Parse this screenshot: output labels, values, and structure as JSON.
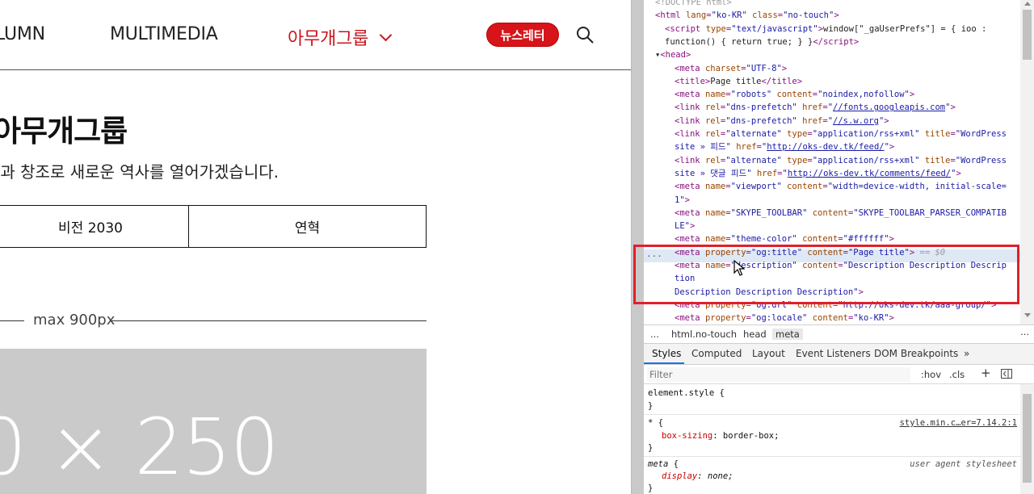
{
  "site": {
    "nav": {
      "column": "LUMN",
      "multimedia": "MULTIMEDIA",
      "group": "아무개그룹",
      "newsletter": "뉴스레터"
    },
    "title": "아무개그룹",
    "subtitle": "선과 창조로 새로운 역사를 열어가겠습니다.",
    "tabs": [
      "비전 2030",
      "연혁"
    ],
    "max_label": "max 900px",
    "placeholder_text": "0 × 250",
    "colors": {
      "accent": "#d7141a",
      "placeholder_bg": "#cacaca"
    }
  },
  "devtools": {
    "dom_lines": [
      {
        "indent": 0,
        "html": "&lt;!DOCTYPE html&gt;",
        "comment": true
      },
      {
        "indent": 0,
        "tag": "html",
        "attrs": [
          [
            "lang",
            "ko-KR"
          ],
          [
            "class",
            "no-touch"
          ]
        ]
      },
      {
        "indent": 1,
        "raw": "<span>&lt;script</span> <span class=\"attr\">type</span>=<span class=\"val\">\"text/javascript\"</span>&gt;<span class=\"txt\">window[\"_gaUserPrefs\"] = { ioo :</span>"
      },
      {
        "indent": 1,
        "raw": "<span class=\"txt\">function() { return true; } }</span>&lt;/script&gt;"
      },
      {
        "indent": 0,
        "raw": "<span class=\"txt\">▾</span>&lt;head&gt;"
      },
      {
        "indent": 2,
        "raw": "&lt;meta <span class=\"attr\">charset</span>=<span class=\"val\">\"UTF-8\"</span>&gt;"
      },
      {
        "indent": 2,
        "raw": "&lt;title&gt;<span class=\"txt\">Page title</span>&lt;/title&gt;"
      },
      {
        "indent": 2,
        "raw": "&lt;meta <span class=\"attr\">name</span>=<span class=\"val\">\"robots\"</span> <span class=\"attr\">content</span>=<span class=\"val\">\"noindex,nofollow\"</span>&gt;"
      },
      {
        "indent": 2,
        "raw": "&lt;link <span class=\"attr\">rel</span>=<span class=\"val\">\"dns-prefetch\"</span> <span class=\"attr\">href</span>=<span class=\"val\">\"</span><span class=\"lnk\">//fonts.googleapis.com</span><span class=\"val\">\"</span>&gt;"
      },
      {
        "indent": 2,
        "raw": "&lt;link <span class=\"attr\">rel</span>=<span class=\"val\">\"dns-prefetch\"</span> <span class=\"attr\">href</span>=<span class=\"val\">\"</span><span class=\"lnk\">//s.w.org</span><span class=\"val\">\"</span>&gt;"
      },
      {
        "indent": 2,
        "raw": "&lt;link <span class=\"attr\">rel</span>=<span class=\"val\">\"alternate\"</span> <span class=\"attr\">type</span>=<span class=\"val\">\"application/rss+xml\"</span> <span class=\"attr\">title</span>=<span class=\"val\">\"WordPress</span>"
      },
      {
        "indent": 2,
        "raw": "<span class=\"val\">site » 피드\"</span> <span class=\"attr\">href</span>=<span class=\"val\">\"</span><span class=\"lnk\">http://oks-dev.tk/feed/</span><span class=\"val\">\"</span>&gt;"
      },
      {
        "indent": 2,
        "raw": "&lt;link <span class=\"attr\">rel</span>=<span class=\"val\">\"alternate\"</span> <span class=\"attr\">type</span>=<span class=\"val\">\"application/rss+xml\"</span> <span class=\"attr\">title</span>=<span class=\"val\">\"WordPress</span>"
      },
      {
        "indent": 2,
        "raw": "<span class=\"val\">site » 댓글 피드\"</span> <span class=\"attr\">href</span>=<span class=\"val\">\"</span><span class=\"lnk\">http://oks-dev.tk/comments/feed/</span><span class=\"val\">\"</span>&gt;"
      },
      {
        "indent": 2,
        "raw": "&lt;meta <span class=\"attr\">name</span>=<span class=\"val\">\"viewport\"</span> <span class=\"attr\">content</span>=<span class=\"val\">\"width=device-width, initial-scale=</span>"
      },
      {
        "indent": 2,
        "raw": "<span class=\"val\">1\"</span>&gt;"
      },
      {
        "indent": 2,
        "raw": "&lt;meta <span class=\"attr\">name</span>=<span class=\"val\">\"SKYPE_TOOLBAR\"</span> <span class=\"attr\">content</span>=<span class=\"val\">\"SKYPE_TOOLBAR_PARSER_COMPATIB</span>"
      },
      {
        "indent": 2,
        "raw": "<span class=\"val\">LE\"</span>&gt;"
      },
      {
        "indent": 2,
        "raw": "&lt;meta <span class=\"attr\">name</span>=<span class=\"val\">\"theme-color\"</span> <span class=\"attr\">content</span>=<span class=\"val\">\"#ffffff\"</span>&gt;"
      },
      {
        "indent": 2,
        "raw": "&lt;meta <span class=\"attr\">property</span>=<span class=\"val\">\"og:title\"</span> <span class=\"attr\">content</span>=<span class=\"val\">\"Page title\"</span>&gt; <span class=\"comm\">== $0</span>"
      },
      {
        "indent": 2,
        "raw": "&lt;meta <span class=\"attr\">name</span>=<span class=\"val\">\"description\"</span> <span class=\"attr\">content</span>=<span class=\"val\">\"Description Description Descrip</span>"
      },
      {
        "indent": 2,
        "raw": "<span class=\"val\">tion</span>"
      },
      {
        "indent": 2,
        "raw": "<span class=\"val\">Description Description Description\"</span>&gt;"
      },
      {
        "indent": 2,
        "raw": "&lt;meta <span class=\"attr\">property</span>=<span class=\"val\">\"og:url\"</span> <span class=\"attr\">content</span>=<span class=\"val\">\"http://oks-dev.tk/aaa-group/\"</span>&gt;"
      },
      {
        "indent": 2,
        "raw": "&lt;meta <span class=\"attr\">property</span>=<span class=\"val\">\"og:locale\"</span> <span class=\"attr\">content</span>=<span class=\"val\">\"ko-KR\"</span>&gt;"
      }
    ],
    "breadcrumb": [
      "...",
      "html.no-touch",
      "head",
      "meta"
    ],
    "panel_tabs": [
      "Styles",
      "Computed",
      "Layout",
      "Event Listeners",
      "DOM Breakpoints",
      "»"
    ],
    "filter_placeholder": "Filter",
    "filter_tools": [
      ":hov",
      ".cls",
      "+"
    ],
    "styles": {
      "element_style": "element.style {",
      "close": "}",
      "rule1_selector": "* {",
      "rule1_source": "style.min.c…er=7.14.2:1",
      "rule1_prop": "box-sizing",
      "rule1_val": " border-box;",
      "rule2_selector": "meta",
      "rule2_brace": " {",
      "rule2_source": "user agent stylesheet",
      "rule2_prop": "display",
      "rule2_val": " none;"
    }
  }
}
